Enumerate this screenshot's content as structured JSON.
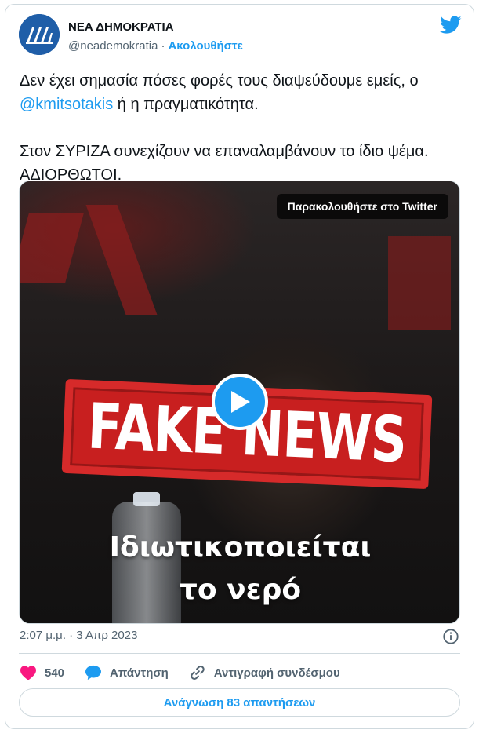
{
  "author": {
    "display_name": "ΝΕΑ ΔΗΜΟΚΡΑΤΙΑ",
    "handle": "@neademokratia",
    "follow_label": "Ακολουθήστε",
    "avatar_color": "#1f5ea8"
  },
  "tweet": {
    "text_line1_prefix": "Δεν έχει σημασία πόσες φορές τους διαψεύδουμε εμείς, ο",
    "mention": "@kmitsotakis",
    "text_line2_suffix": " ή η πραγματικότητα.",
    "text_paragraph2": "Στον ΣΥΡΙΖΑ συνεχίζουν να επαναλαμβάνουν το ίδιο ψέμα. ΑΔΙΟΡΘΩΤΟΙ."
  },
  "media": {
    "watch_label": "Παρακολουθήστε στο Twitter",
    "stamp_text": "FAKE NEWS",
    "caption_line1": "Ιδιωτικοποιείται",
    "caption_line2": "το νερό",
    "accent_color": "#1d9bf0",
    "stamp_color": "#c81f1f"
  },
  "meta": {
    "timestamp": "2:07 μ.μ. · 3 Απρ 2023"
  },
  "actions": {
    "likes": "540",
    "reply_label": "Απάντηση",
    "copy_link_label": "Αντιγραφή συνδέσμου",
    "read_replies_label": "Ανάγνωση 83 απαντήσεων"
  },
  "icons": [
    "twitter-bird-icon",
    "info-icon",
    "heart-icon",
    "reply-bubble-icon",
    "link-icon",
    "play-icon"
  ]
}
